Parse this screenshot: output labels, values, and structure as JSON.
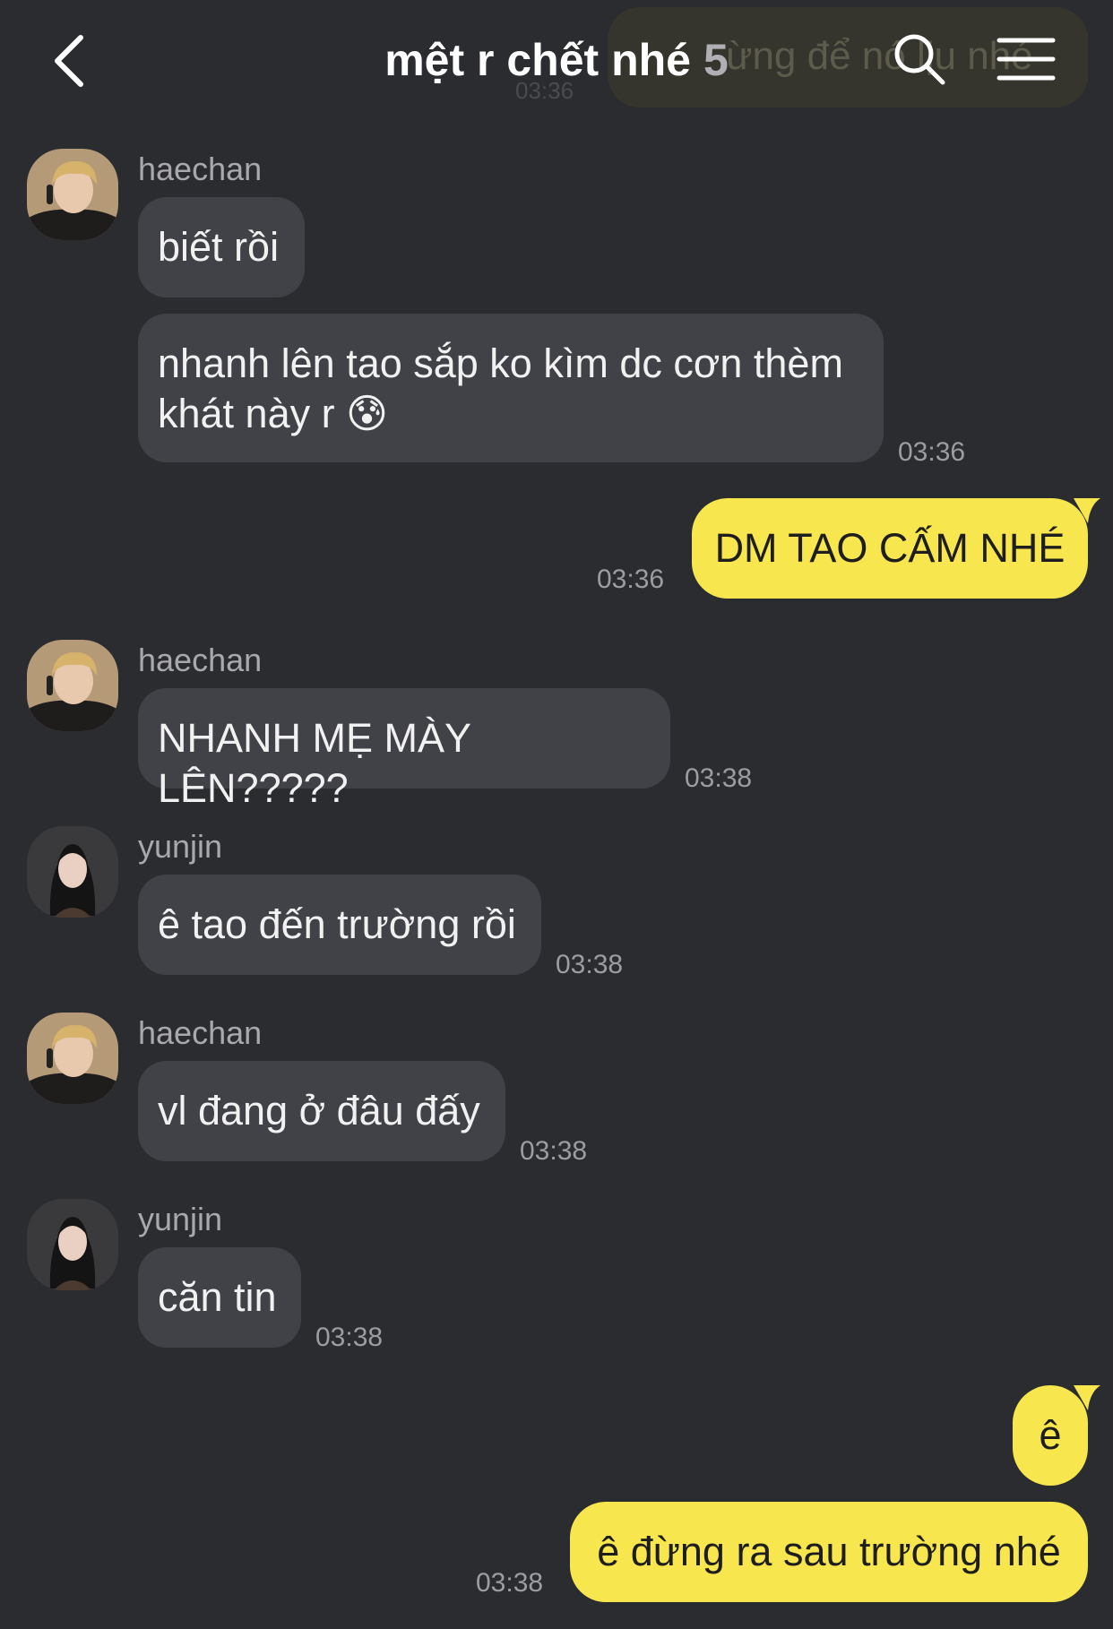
{
  "header": {
    "title": "mệt r chết nhé",
    "member_count": "5",
    "ghost_preview": "ừng để nó lịu nhé",
    "ghost_time": "03:36"
  },
  "messages": [
    {
      "sender": "haechan",
      "text": "biết rồi"
    },
    {
      "text": "nhanh lên tao sắp ko kìm dc cơn thèm",
      "text2": "khát này r 😰",
      "time": "03:36"
    },
    {
      "text": "DM TAO CẤM NHÉ",
      "time": "03:36"
    },
    {
      "sender": "haechan",
      "text": "NHANH MẸ MÀY LÊN?????",
      "time": "03:38"
    },
    {
      "sender": "yunjin",
      "text": "ê tao đến trường rồi",
      "time": "03:38"
    },
    {
      "sender": "haechan",
      "text": "vl đang ở đâu đấy",
      "time": "03:38"
    },
    {
      "sender": "yunjin",
      "text": "căn tin",
      "time": "03:38"
    },
    {
      "text": "ê"
    },
    {
      "text": "ê đừng ra sau trường nhé",
      "time": "03:38"
    }
  ],
  "colors": {
    "background": "#2b2c30",
    "incoming_bubble": "#414248",
    "outgoing_bubble": "#f8e64f",
    "timestamp": "#9c9ca1"
  },
  "icons": {
    "back": "chevron-left-icon",
    "search": "search-icon",
    "menu": "hamburger-menu-icon"
  }
}
